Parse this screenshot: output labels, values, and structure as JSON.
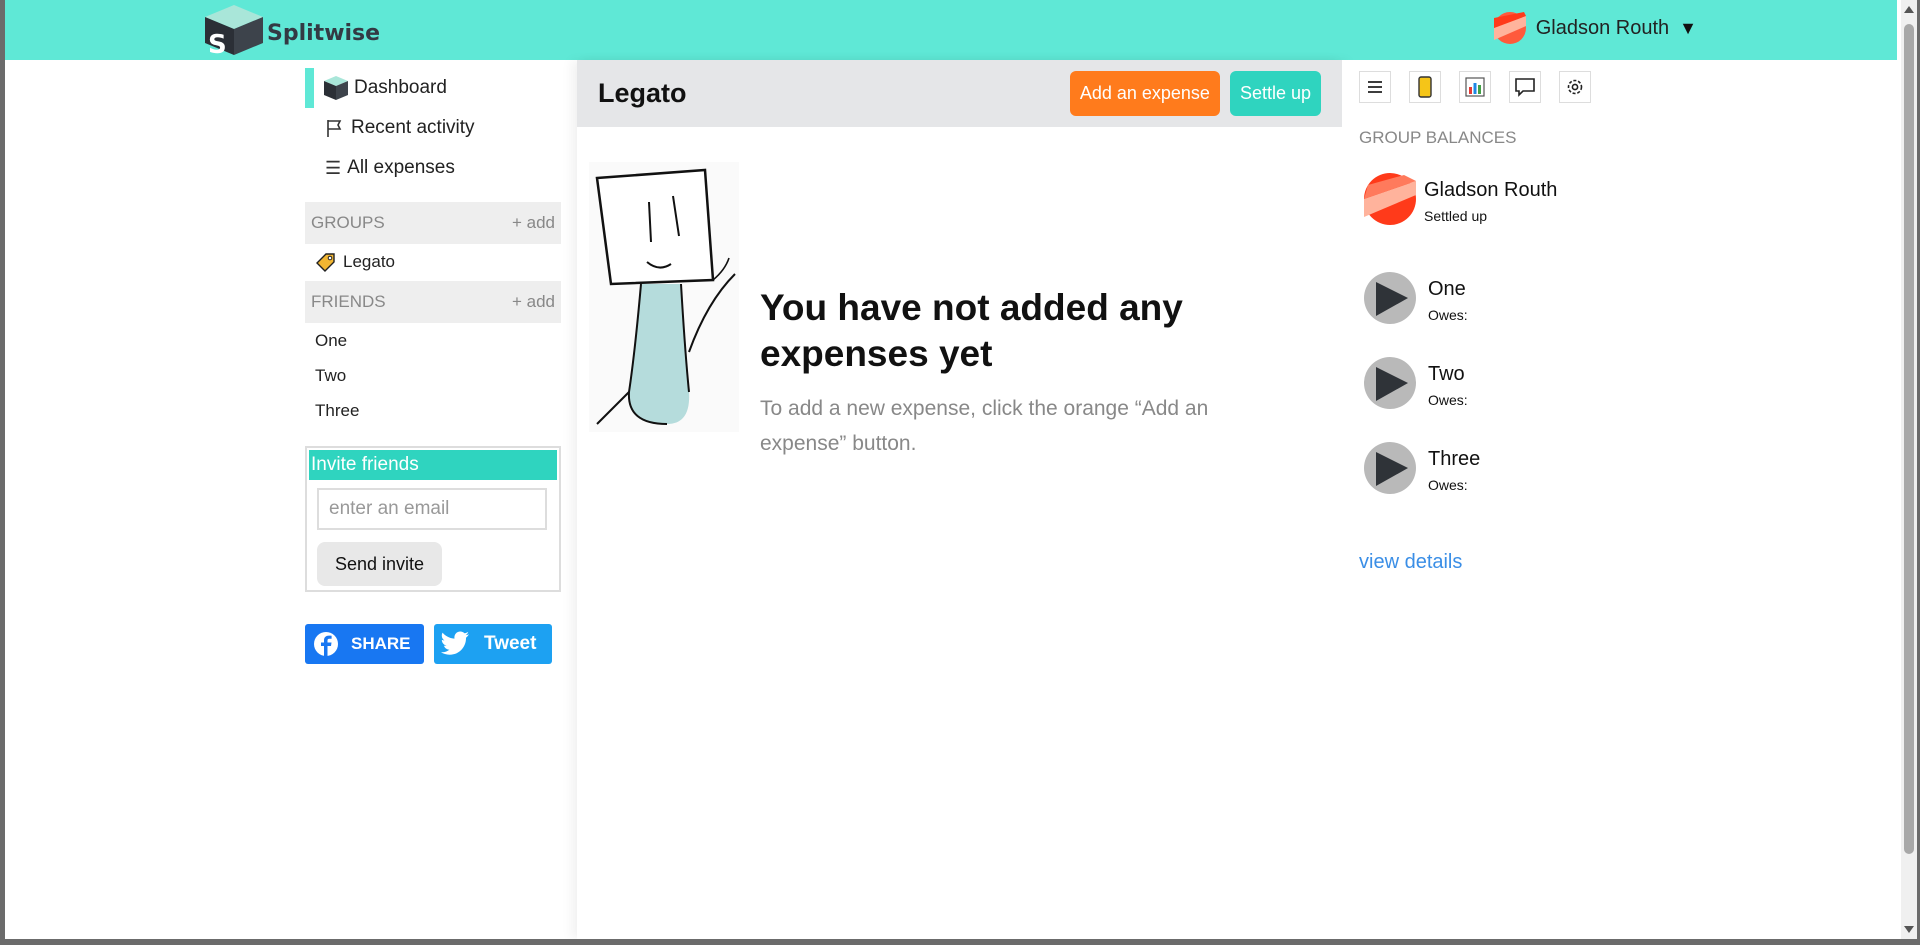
{
  "app": {
    "name": "Splitwise"
  },
  "header": {
    "user_name": "Gladson Routh",
    "caret": "▼"
  },
  "sidebar": {
    "nav": [
      {
        "label": "Dashboard",
        "icon": "splitwise-logo-icon"
      },
      {
        "label": "Recent activity",
        "icon": "flag-icon"
      },
      {
        "label": "All expenses",
        "icon": "list-icon",
        "glyph": "☰"
      }
    ],
    "groups": {
      "title": "GROUPS",
      "add": "+ add",
      "items": [
        {
          "label": "Legato",
          "icon": "tag-icon"
        }
      ]
    },
    "friends": {
      "title": "FRIENDS",
      "add": "+ add",
      "items": [
        "One",
        "Two",
        "Three"
      ]
    },
    "invite": {
      "title": "Invite friends",
      "placeholder": "enter an email",
      "button": "Send invite"
    },
    "social": {
      "facebook": "SHARE",
      "twitter": "Tweet"
    }
  },
  "main": {
    "title": "Legato",
    "add_expense": "Add an expense",
    "settle_up": "Settle up",
    "empty_title": "You have not added any expenses yet",
    "empty_sub": "To add a new expense, click the orange “Add an expense” button."
  },
  "right": {
    "tools": [
      "list-icon",
      "phone-icon",
      "chart-icon",
      "comment-icon",
      "settings-icon"
    ],
    "balances_title": "GROUP BALANCES",
    "people": [
      {
        "name": "Gladson Routh",
        "status": "Settled up"
      },
      {
        "name": "One",
        "status": "Owes:"
      },
      {
        "name": "Two",
        "status": "Owes:"
      },
      {
        "name": "Three",
        "status": "Owes:"
      }
    ],
    "view_details": "view details"
  },
  "colors": {
    "brand": "#5fe8d6",
    "teal": "#2fd4bf",
    "orange": "#ff7b1c",
    "link": "#3a8ee6"
  }
}
